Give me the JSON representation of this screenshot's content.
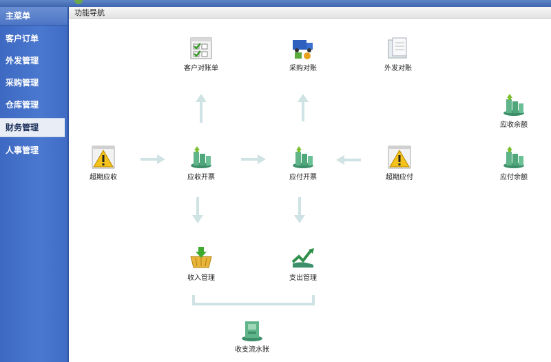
{
  "sidebar": {
    "header": "主菜单",
    "items": [
      {
        "label": "客户订单"
      },
      {
        "label": "外发管理"
      },
      {
        "label": "采购管理"
      },
      {
        "label": "仓库管理"
      },
      {
        "label": "财务管理"
      },
      {
        "label": "人事管理"
      }
    ],
    "active_index": 4
  },
  "breadcrumb": "功能导航",
  "nodes": {
    "customer_statement": "客户对账单",
    "purchase_reconcile": "采购对账",
    "outsource_reconcile": "外发对账",
    "overdue_receivable": "超期应收",
    "receivable_invoice": "应收开票",
    "payable_invoice": "应付开票",
    "overdue_payable": "超期应付",
    "receivable_balance": "应收余额",
    "payable_balance": "应付余额",
    "income_management": "收入管理",
    "expense_management": "支出管理",
    "cash_journal": "收支流水账"
  },
  "colors": {
    "sidebar": "#4a78cf",
    "arrow": "#cfe2e4",
    "active_item_bg": "#e9edf6"
  }
}
